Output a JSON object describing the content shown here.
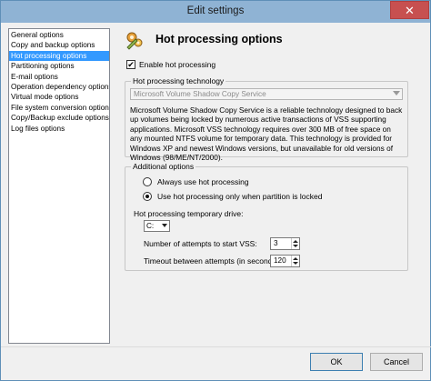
{
  "window": {
    "title": "Edit settings",
    "close_glyph": "✕"
  },
  "nav": {
    "items": [
      "General options",
      "Copy and backup options",
      "Hot processing options",
      "Partitioning options",
      "E-mail options",
      "Operation dependency options",
      "Virtual mode options",
      "File system conversion options",
      "Copy/Backup exclude options",
      "Log files options"
    ],
    "selected_index": 2
  },
  "header": {
    "title": "Hot processing options",
    "icon": "wrench-cogs-icon"
  },
  "enable": {
    "label": "Enable hot processing",
    "checked": true,
    "check_glyph": "✔"
  },
  "technology": {
    "legend": "Hot processing technology",
    "selected": "Microsoft Volume Shadow Copy Service",
    "description": "Microsoft Volume Shadow Copy Service is a reliable technology designed to back up volumes being locked by numerous active transactions of VSS supporting applications. Microsoft VSS technology requires over 300 MB of free space on any mounted NTFS volume for temporary data. This technology is provided for Windows XP and newest Windows versions, but unavailable for old versions of Windows (98/ME/NT/2000)."
  },
  "additional": {
    "legend": "Additional options",
    "radio_always": "Always use hot processing",
    "radio_locked": "Use hot processing only when partition is locked",
    "selected_radio": "locked",
    "drive_label": "Hot processing temporary drive:",
    "drive_value": "C:",
    "attempts_label": "Number of attempts to start VSS:",
    "attempts_value": "3",
    "timeout_label": "Timeout between attempts (in seconds):",
    "timeout_value": "120"
  },
  "footer": {
    "ok_label": "OK",
    "cancel_label": "Cancel"
  }
}
